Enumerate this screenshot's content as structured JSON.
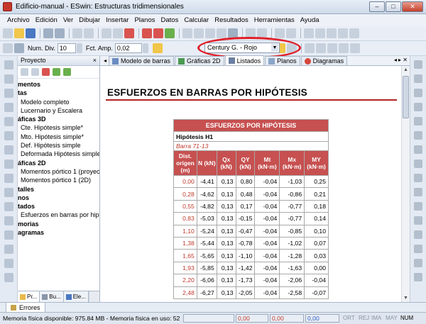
{
  "window": {
    "title": "Edificio-manual - ESwin: Estructuras tridimensionales",
    "minimize": "–",
    "maximize": "□",
    "close": "✕"
  },
  "menu": [
    "Archivo",
    "Edición",
    "Ver",
    "Dibujar",
    "Insertar",
    "Planos",
    "Datos",
    "Calcular",
    "Resultados",
    "Herramientas",
    "Ayuda"
  ],
  "toolbar2": {
    "num_div_label": "Num. Div.",
    "num_div_value": "10",
    "fct_amp_label": "Fct. Amp.",
    "fct_amp_value": "0,02",
    "font_value": "Century G. - Rojo"
  },
  "project": {
    "title": "Proyecto",
    "tree": [
      "mentos",
      "tas",
      "Modelo completo",
      "Lucernario y Escalera",
      "áficas 3D",
      "Cte. Hipótesis simple*",
      "Mto. Hipótesis simple*",
      "Def. Hipótesis simple",
      "Deformada Hipótesis simple",
      "áficas 2D",
      "Momentos pórtico 1 (proyec",
      "Momentos pórtico 1 (2D)",
      "talles",
      "nos",
      "tados",
      "Esfuerzos en barras por hipó",
      "morias",
      "agramas"
    ],
    "tabs": [
      "Pr...",
      "Bu...",
      "Ele..."
    ]
  },
  "main": {
    "tabs": [
      "Modelo de barras",
      "Gráficas 2D",
      "Listados",
      "Planos",
      "Diagramas"
    ],
    "doc_title": "ESFUERZOS EN BARRAS POR HIPÓTESIS"
  },
  "report": {
    "header": "ESFUERZOS POR HIPÓTESIS",
    "hypothesis": "Hipótesis H1",
    "bar": "Barra 71-13",
    "columns": [
      "Dist. origen (m)",
      "N (kN)",
      "Qx (kN)",
      "QY (kN)",
      "Mt (kN·m)",
      "Mx (kN·m)",
      "MY (kN·m)"
    ],
    "rows": [
      [
        "0,00",
        "-4,41",
        "0,13",
        "0,80",
        "-0,04",
        "-1,03",
        "0,25"
      ],
      [
        "0,28",
        "-4,62",
        "0,13",
        "0,48",
        "-0,04",
        "-0,86",
        "0,21"
      ],
      [
        "0,55",
        "-4,82",
        "0,13",
        "0,17",
        "-0,04",
        "-0,77",
        "0,18"
      ],
      [
        "0,83",
        "-5,03",
        "0,13",
        "-0,15",
        "-0,04",
        "-0,77",
        "0,14"
      ],
      [
        "1,10",
        "-5,24",
        "0,13",
        "-0,47",
        "-0,04",
        "-0,85",
        "0,10"
      ],
      [
        "1,38",
        "-5,44",
        "0,13",
        "-0,78",
        "-0,04",
        "-1,02",
        "0,07"
      ],
      [
        "1,65",
        "-5,65",
        "0,13",
        "-1,10",
        "-0,04",
        "-1,28",
        "0,03"
      ],
      [
        "1,93",
        "-5,85",
        "0,13",
        "-1,42",
        "-0,04",
        "-1,63",
        "0,00"
      ],
      [
        "2,20",
        "-6,06",
        "0,13",
        "-1,73",
        "-0,04",
        "-2,06",
        "-0,04"
      ],
      [
        "2,48",
        "-6,27",
        "0,13",
        "-2,05",
        "-0,04",
        "-2,58",
        "-0,07"
      ]
    ]
  },
  "bottom": {
    "errors_tab": "Errores",
    "status_msg": "Memoria física disponible: 975.84 MB - Memoria física en uso: 52",
    "box1": "0,00",
    "box2": "0,00",
    "box3": "0,00",
    "ind": [
      "ORT",
      "REJ",
      "IMA",
      "MAY",
      "NUM"
    ]
  },
  "colors": {
    "accent_red": "#c75050",
    "highlight_oval": "#e0202a",
    "title_rule": "#b02424"
  }
}
